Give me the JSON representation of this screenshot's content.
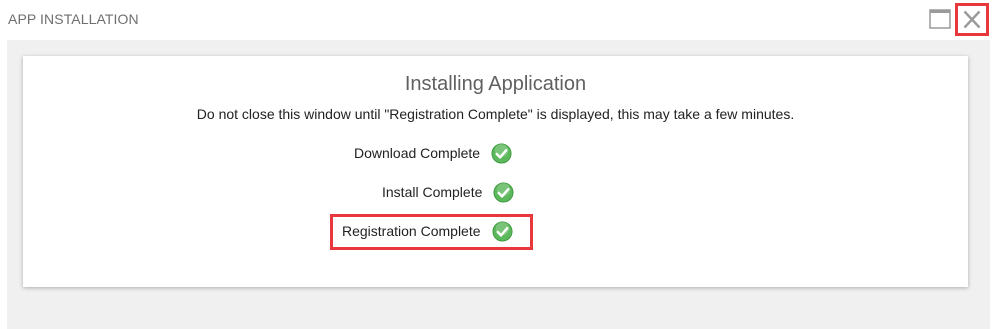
{
  "window": {
    "title": "APP INSTALLATION",
    "maximize_icon": "maximize-icon",
    "close_icon": "close-icon"
  },
  "dialog": {
    "heading": "Installing Application",
    "message": "Do not close this window until \"Registration Complete\" is displayed, this may take a few minutes.",
    "steps": [
      {
        "label": "Download Complete",
        "status": "complete",
        "icon": "check-circle-icon"
      },
      {
        "label": "Install Complete",
        "status": "complete",
        "icon": "check-circle-icon"
      },
      {
        "label": "Registration Complete",
        "status": "complete",
        "icon": "check-circle-icon",
        "highlighted": true
      }
    ]
  },
  "colors": {
    "highlight": "#e8383d",
    "check_green": "#5cb85c",
    "background": "#f0f0f0"
  }
}
